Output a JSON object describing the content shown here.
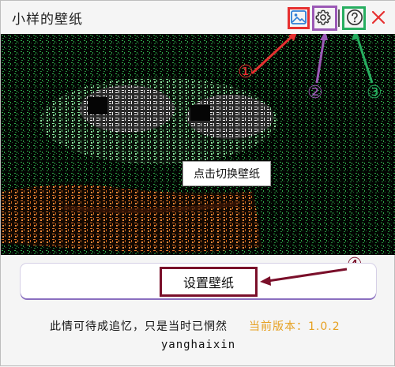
{
  "window": {
    "title": "小样的壁纸"
  },
  "toolbar": {
    "image_icon": "image-icon",
    "settings_icon": "gear-icon",
    "help_icon": "question-icon",
    "close_icon": "close-icon"
  },
  "preview": {
    "tooltip": "点击切换壁纸"
  },
  "callouts": {
    "one": "①",
    "two": "②",
    "three": "③",
    "four": "④"
  },
  "actions": {
    "set_wallpaper_label": "设置壁纸"
  },
  "footer": {
    "motto": "此情可待成追忆，只是当时已惘然",
    "version": "当前版本：1.0.2",
    "author": "yanghaixin"
  },
  "colors": {
    "accent_red": "#e63030",
    "accent_purple": "#9b59b6",
    "accent_green": "#27ae60",
    "accent_maroon": "#7a0f2a",
    "version_orange": "#e6a020"
  }
}
